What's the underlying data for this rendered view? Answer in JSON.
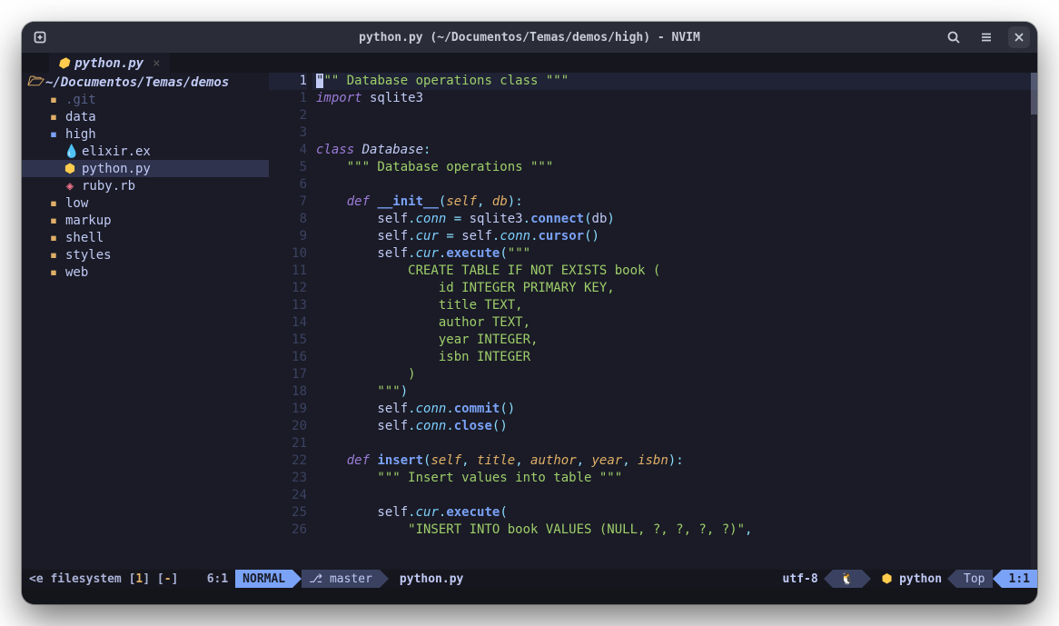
{
  "title": "python.py (~/Documentos/Temas/demos/high) - NVIM",
  "tab": {
    "icon": "⬢",
    "label": "python.py",
    "close": "×"
  },
  "tree": {
    "root": "~/Documentos/Temas/demos",
    "git": ".git",
    "data": "data",
    "high": "high",
    "elixir": "elixir.ex",
    "python": "python.py",
    "ruby": "ruby.rb",
    "low": "low",
    "markup": "markup",
    "shell": "shell",
    "styles": "styles",
    "web": "web"
  },
  "gutter": {
    "l1": "1",
    "l2": "1",
    "l3": "2",
    "l4": "3",
    "l5": "4",
    "l6": "5",
    "l7": "6",
    "l8": "7",
    "l9": "8",
    "l10": "9",
    "l11": "10",
    "l12": "11",
    "l13": "12",
    "l14": "13",
    "l15": "14",
    "l16": "15",
    "l17": "16",
    "l18": "17",
    "l19": "18",
    "l20": "19",
    "l21": "20",
    "l22": "21",
    "l23": "22",
    "l24": "23",
    "l25": "24",
    "l26": "25",
    "l27": "26"
  },
  "code": {
    "l1a": "\"",
    "l1b": "\"\" Database operations class \"\"\"",
    "l2a": "import",
    "l2b": " sqlite3",
    "l5a": "class ",
    "l5b": "Database",
    "l5c": ":",
    "l6": "    \"\"\" Database operations \"\"\"",
    "l8a": "    ",
    "l8b": "def ",
    "l8c": "__init__",
    "l8d": "(",
    "l8e": "self",
    "l8f": ", ",
    "l8g": "db",
    "l8h": ")",
    "l8i": ":",
    "l9a": "        self",
    "l9b": ".",
    "l9c": "conn",
    "l9d": " = ",
    "l9e": "sqlite3",
    "l9f": ".",
    "l9g": "connect",
    "l9h": "(",
    "l9i": "db",
    "l9j": ")",
    "l10a": "        self",
    "l10b": ".",
    "l10c": "cur",
    "l10d": " = ",
    "l10e": "self",
    "l10f": ".",
    "l10g": "conn",
    "l10h": ".",
    "l10i": "cursor",
    "l10j": "(",
    "l10k": ")",
    "l11a": "        self",
    "l11b": ".",
    "l11c": "cur",
    "l11d": ".",
    "l11e": "execute",
    "l11f": "(",
    "l11g": "\"\"\"",
    "l12": "            CREATE TABLE IF NOT EXISTS book (",
    "l13": "                id INTEGER PRIMARY KEY,",
    "l14": "                title TEXT,",
    "l15": "                author TEXT,",
    "l16": "                year INTEGER,",
    "l17": "                isbn INTEGER",
    "l18": "            )",
    "l19a": "        \"\"\"",
    "l19b": ")",
    "l20a": "        self",
    "l20b": ".",
    "l20c": "conn",
    "l20d": ".",
    "l20e": "commit",
    "l20f": "(",
    "l20g": ")",
    "l21a": "        self",
    "l21b": ".",
    "l21c": "conn",
    "l21d": ".",
    "l21e": "close",
    "l21f": "(",
    "l21g": ")",
    "l23a": "    ",
    "l23b": "def ",
    "l23c": "insert",
    "l23d": "(",
    "l23e": "self",
    "l23f": ", ",
    "l23g": "title",
    "l23h": ", ",
    "l23i": "author",
    "l23j": ", ",
    "l23k": "year",
    "l23l": ", ",
    "l23m": "isbn",
    "l23n": ")",
    "l23o": ":",
    "l24": "        \"\"\" Insert values into table \"\"\"",
    "l26a": "        self",
    "l26b": ".",
    "l26c": "cur",
    "l26d": ".",
    "l26e": "execute",
    "l26f": "(",
    "l27a": "            \"INSERT INTO book VALUES (NULL, ?, ?, ?, ?)\"",
    "l27b": ","
  },
  "status": {
    "left1": "<e filesystem [",
    "left2": "1",
    "left3": "] [",
    "left4": "-",
    "left5": "]",
    "lnpos": "6:1",
    "mode": "NORMAL",
    "branch_ic": "⎇",
    "branch": "master",
    "file": "python.py",
    "enc": "utf-8",
    "os_ic": "🐧",
    "ft_ic": "⬢",
    "ft": "python",
    "pos": "Top",
    "rc": "1:1"
  }
}
